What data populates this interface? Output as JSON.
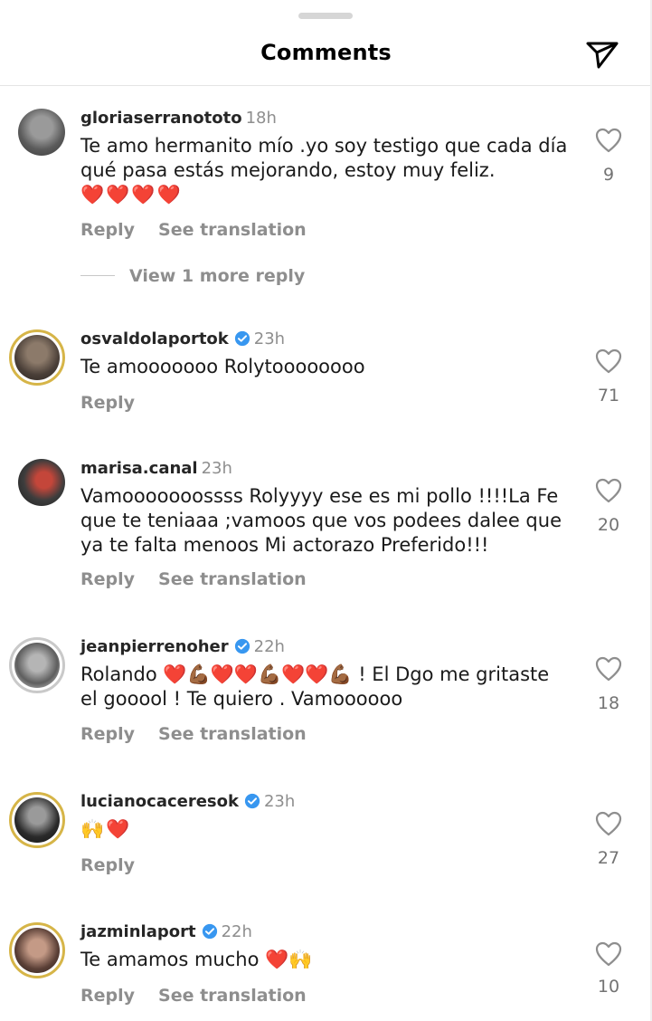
{
  "header": {
    "title": "Comments"
  },
  "comments": [
    {
      "username": "gloriaserranototo",
      "time": "18h",
      "verified": false,
      "text": "Te amo hermanito mío .yo soy testigo que cada día qué pasa estás mejorando, estoy muy feliz.",
      "emoji": "❤️❤️❤️❤️",
      "reply": "Reply",
      "translate": "See translation",
      "likes": "9"
    },
    {
      "username": "osvaldolaportok",
      "time": "23h",
      "verified": true,
      "text": "Te amooooooo Rolytoooooooo",
      "reply": "Reply",
      "likes": "71"
    },
    {
      "username": "marisa.canal",
      "time": "23h",
      "verified": false,
      "text": "Vamooooooossss Rolyyyy ese es mi pollo !!!!La Fe  que te teniaaa ;vamoos que vos podees dalee que ya te falta menoos Mi actorazo Preferido!!!",
      "reply": "Reply",
      "translate": "See translation",
      "likes": "20"
    },
    {
      "username": "jeanpierrenoher",
      "time": "22h",
      "verified": true,
      "text": "Rolando ❤️💪🏾❤️❤️💪🏾❤️❤️💪🏾 ! El Dgo me gritaste el gooool ! Te quiero . Vamoooooo",
      "reply": "Reply",
      "translate": "See translation",
      "likes": "18"
    },
    {
      "username": "lucianocaceresok",
      "time": "23h",
      "verified": true,
      "text": "🙌❤️",
      "reply": "Reply",
      "likes": "27"
    },
    {
      "username": "jazminlaport",
      "time": "22h",
      "verified": true,
      "text": "Te amamos mucho ❤️🙌",
      "reply": "Reply",
      "translate": "See translation",
      "likes": "10"
    }
  ],
  "view_more": "View 1 more reply",
  "colors": {
    "ring": "#d6b548",
    "verified": "#3897f0",
    "muted": "#8e8e8e"
  }
}
